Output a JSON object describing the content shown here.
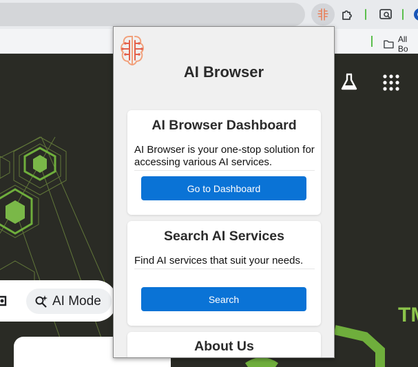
{
  "popup": {
    "title": "AI Browser",
    "cards": [
      {
        "title": "AI Browser Dashboard",
        "text": "AI Browser is your one-stop solution for accessing various AI services.",
        "button": "Go to Dashboard"
      },
      {
        "title": "Search AI Services",
        "text": "Find AI services that suit your needs.",
        "button": "Search"
      },
      {
        "title": "About Us"
      }
    ]
  },
  "bookmarks": {
    "folder_label": "All Bo"
  },
  "page": {
    "ai_mode_label": "AI Mode",
    "trademark_text": "TM"
  },
  "icons": {
    "extension_logo": "brain-circuit-icon",
    "puzzle": "puzzle-icon",
    "tab_search": "tab-search-icon",
    "labs": "flask-icon",
    "apps": "apps-grid-icon"
  },
  "colors": {
    "button_blue": "#0a73d6",
    "brand_green": "#8bc34a"
  }
}
